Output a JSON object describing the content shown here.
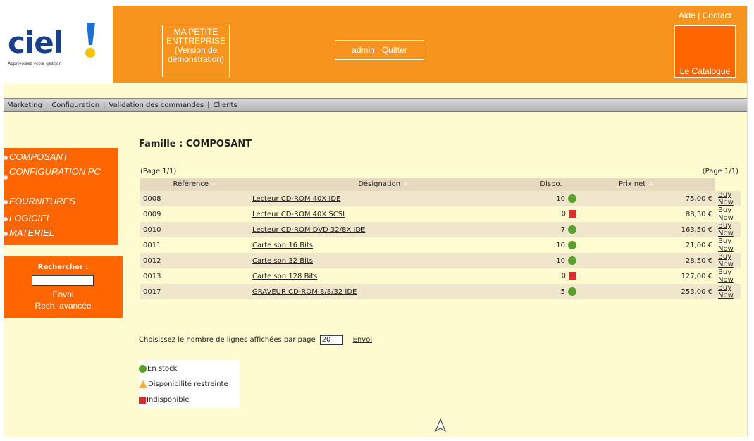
{
  "header": {
    "logo_text": "ciel",
    "logo_tagline": "Apprivoisez votre gestion",
    "company_line1": "MA PETITE",
    "company_line2": "ENTTREPRISE",
    "company_line3": "(Version de",
    "company_line4": "démonstration)",
    "user": "admin",
    "logout": "Quitter",
    "help_link": "Aide",
    "contact_link": "Contact",
    "link_separator": "|",
    "catalogue": "Le Catalogue"
  },
  "menu": {
    "items": [
      {
        "label": "Marketing"
      },
      {
        "label": "Configuration"
      },
      {
        "label": "Validation des commandes"
      },
      {
        "label": "Clients"
      }
    ],
    "separator": "|"
  },
  "sidebar": {
    "items": [
      {
        "label": "COMPOSANT"
      },
      {
        "label": "CONFIGURATION PC"
      },
      {
        "label": "FOURNITURES"
      },
      {
        "label": "LOGICIEL"
      },
      {
        "label": "MATERIEL"
      }
    ],
    "search_label": "Rechercher :",
    "search_value": "",
    "search_button": "Envoi",
    "advanced_search": "Rech. avancée"
  },
  "main": {
    "title": "Famille : COMPOSANT",
    "page_info": "(Page 1/1)",
    "columns": {
      "reference": "Référence",
      "designation": "Désignation",
      "dispo": "Dispo.",
      "price": "Prix net"
    },
    "sort_glyph": "÷",
    "rows": [
      {
        "ref": "0008",
        "designation": "Lecteur CD-ROM 40X IDE",
        "qty": "10",
        "status": "in-stock",
        "price": "75,00 €",
        "action": "Buy Now"
      },
      {
        "ref": "0009",
        "designation": "Lecteur CD-ROM 40X SCSI",
        "qty": "0",
        "status": "unavailable",
        "price": "88,50 €",
        "action": "Buy Now"
      },
      {
        "ref": "0010",
        "designation": "Lecteur CD-ROM DVD 32/8X IDE",
        "qty": "7",
        "status": "in-stock",
        "price": "163,50 €",
        "action": "Buy Now"
      },
      {
        "ref": "0011",
        "designation": "Carte son 16 Bits",
        "qty": "10",
        "status": "in-stock",
        "price": "21,00 €",
        "action": "Buy Now"
      },
      {
        "ref": "0012",
        "designation": "Carte son 32 Bits",
        "qty": "10",
        "status": "in-stock",
        "price": "28,50 €",
        "action": "Buy Now"
      },
      {
        "ref": "0013",
        "designation": "Carte son 128 Bits",
        "qty": "0",
        "status": "unavailable",
        "price": "127,00 €",
        "action": "Buy Now"
      },
      {
        "ref": "0017",
        "designation": "GRAVEUR CD-ROM 8/8/32 IDE",
        "qty": "5",
        "status": "in-stock",
        "price": "253,00 €",
        "action": "Buy Now"
      }
    ],
    "lines_per_page_label": "Choisissez le nombre de lignes affichées par page",
    "lines_per_page_value": "20",
    "lines_submit": "Envoi"
  },
  "legend": {
    "in_stock": "En stock",
    "limited": "Disponibilité restreinte",
    "unavailable": "Indisponible"
  },
  "colors": {
    "header_orange": "#f7941d",
    "nav_orange": "#ff6600",
    "page_background": "#fffbd0",
    "in_stock": "#5aa02c",
    "unavailable": "#d62e2e",
    "limited": "#f5b041"
  }
}
